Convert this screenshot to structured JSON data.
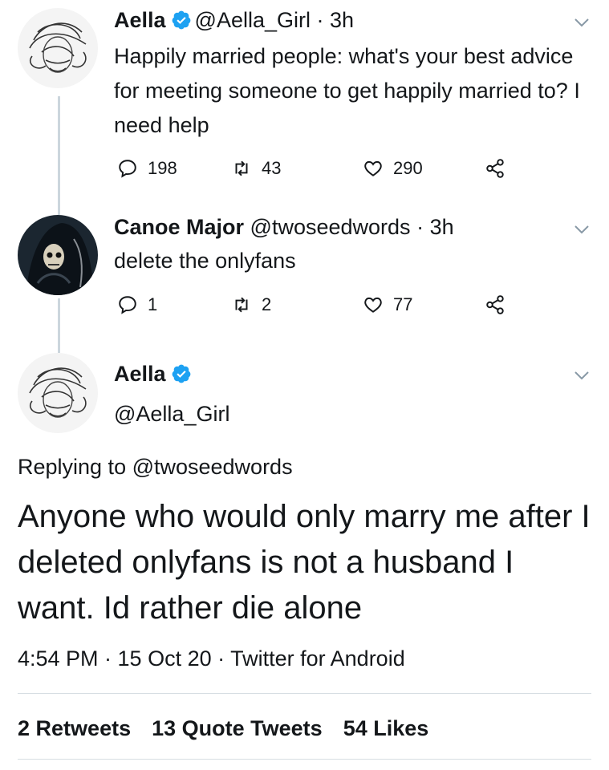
{
  "tweets": [
    {
      "name": "Aella",
      "verified": true,
      "handle": "@Aella_Girl",
      "separator": "·",
      "time": "3h",
      "text": "Happily married people: what's your best advice for meeting someone to get happily married to? I need help",
      "replies": "198",
      "retweets": "43",
      "likes": "290"
    },
    {
      "name": "Canoe Major",
      "verified": false,
      "handle": "@twoseedwords",
      "separator": "·",
      "time": "3h",
      "text": "delete the onlyfans",
      "replies": "1",
      "retweets": "2",
      "likes": "77"
    }
  ],
  "main_tweet": {
    "name": "Aella",
    "handle": "@Aella_Girl",
    "replying_to": "Replying to @twoseedwords",
    "text": "Anyone who would only marry me after I deleted onlyfans is not a husband I want. Id rather die alone",
    "meta": "4:54 PM · 15 Oct 20 · Twitter for Android",
    "stats": [
      {
        "count": "2",
        "label": "Retweets"
      },
      {
        "count": "13",
        "label": "Quote Tweets"
      },
      {
        "count": "54",
        "label": "Likes"
      }
    ]
  },
  "icons": {
    "reply": "reply-icon",
    "retweet": "retweet-icon",
    "like": "heart-icon",
    "share": "share-icon",
    "verified": "verified-badge-icon",
    "menu": "chevron-down-icon"
  },
  "colors": {
    "verified": "#1da1f2",
    "icon_gray": "#657786",
    "thread_line": "#ccd6dd"
  }
}
